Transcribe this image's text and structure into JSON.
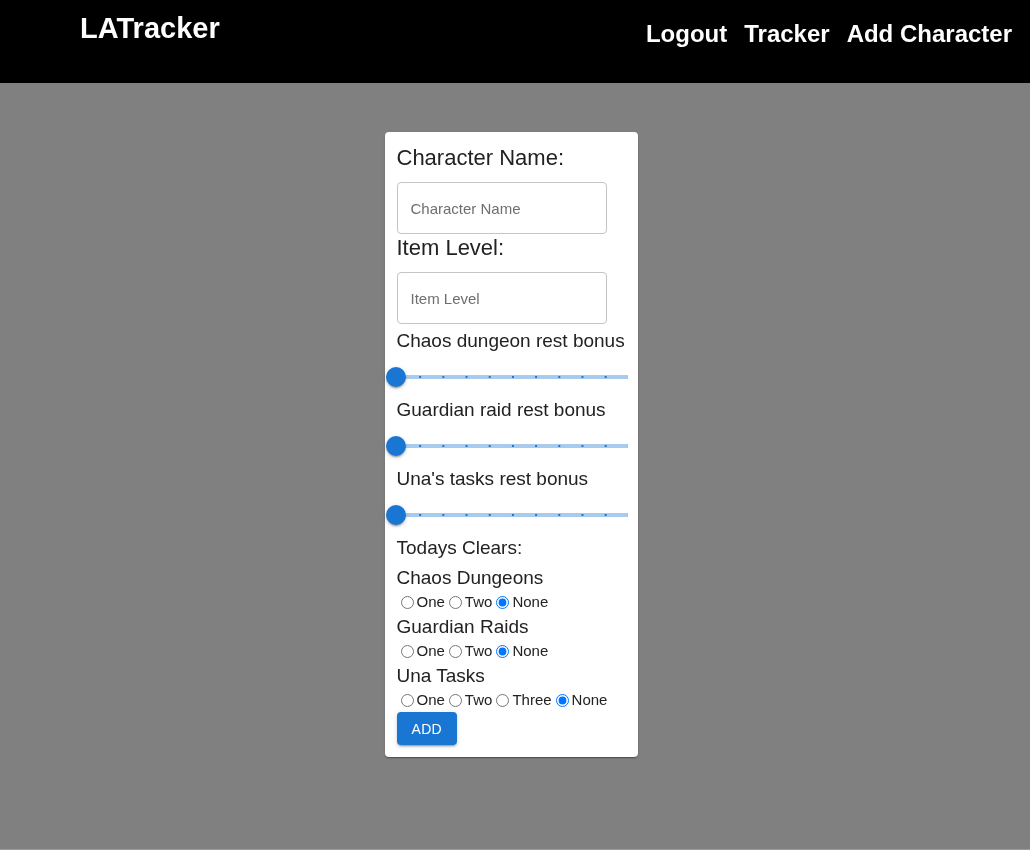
{
  "header": {
    "logo": "LATracker",
    "nav": [
      {
        "label": "Logout"
      },
      {
        "label": "Tracker"
      },
      {
        "label": "Add Character"
      }
    ]
  },
  "form": {
    "fields": [
      {
        "label": "Character Name:",
        "placeholder": "Character Name"
      },
      {
        "label": "Item Level:",
        "placeholder": "Item Level"
      }
    ],
    "rest_bonuses": [
      {
        "label": "Chaos dungeon rest bonus",
        "level": 0
      },
      {
        "label": "Guardian raid rest bonus",
        "level": 0
      },
      {
        "label": "Una's tasks rest bonus",
        "level": 0
      }
    ],
    "clears_title": "Todays Clears:",
    "clears": [
      {
        "label": "Chaos Dungeons",
        "options": [
          {
            "label": "One",
            "selected": false
          },
          {
            "label": "Two",
            "selected": false
          },
          {
            "label": "None",
            "selected": true
          }
        ]
      },
      {
        "label": "Guardian Raids",
        "options": [
          {
            "label": "One",
            "selected": false
          },
          {
            "label": "Two",
            "selected": false
          },
          {
            "label": "None",
            "selected": true
          }
        ]
      },
      {
        "label": "Una Tasks",
        "options": [
          {
            "label": "One",
            "selected": false
          },
          {
            "label": "Two",
            "selected": false
          },
          {
            "label": "Three",
            "selected": false
          },
          {
            "label": "None",
            "selected": true
          }
        ]
      }
    ],
    "submit": "ADD"
  }
}
